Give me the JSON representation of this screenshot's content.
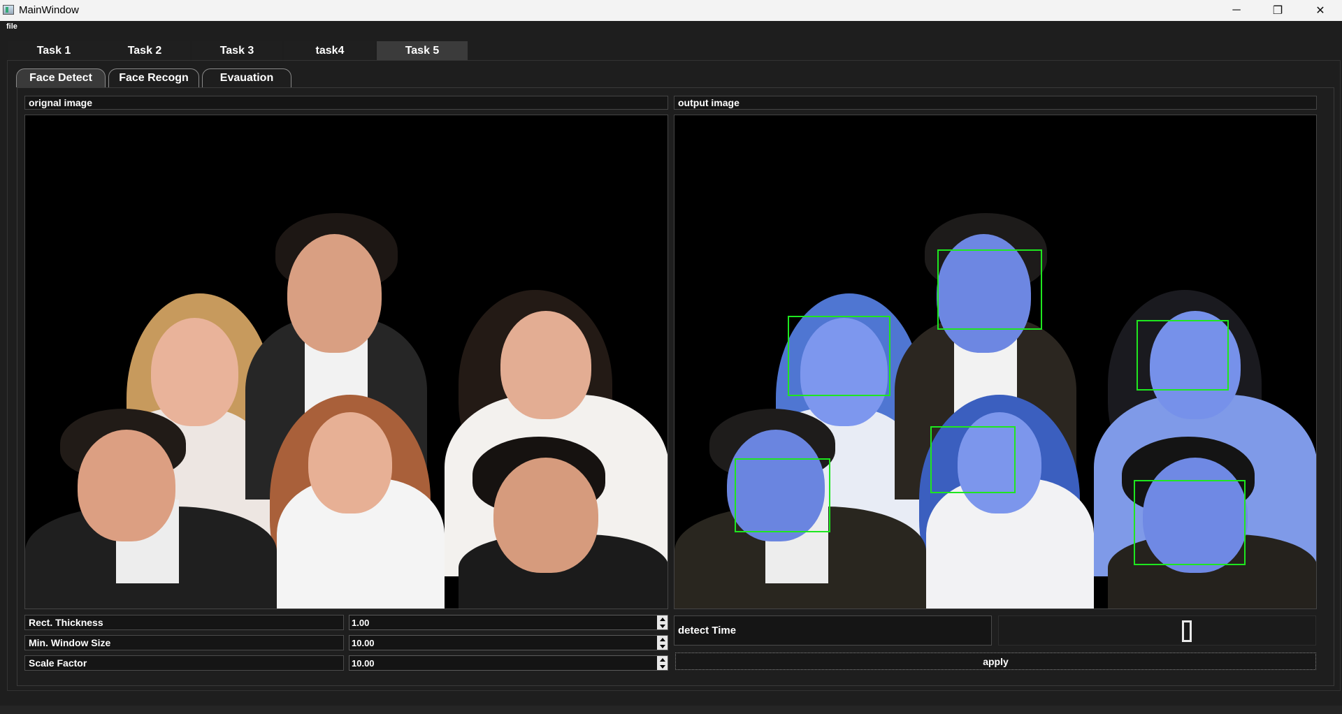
{
  "window": {
    "title": "MainWindow",
    "controls": {
      "minimize": "─",
      "maximize": "❐",
      "close": "✕"
    }
  },
  "menu": {
    "file": "file"
  },
  "main_tabs": [
    {
      "label": "Task 1"
    },
    {
      "label": "Task 2"
    },
    {
      "label": "Task 3"
    },
    {
      "label": "task4"
    },
    {
      "label": "Task 5",
      "active": true
    }
  ],
  "sub_tabs": [
    {
      "label": "Face Detect",
      "active": true
    },
    {
      "label": "Face Recogn"
    },
    {
      "label": "Evauation"
    }
  ],
  "face_detect": {
    "original_label": "orignal image",
    "output_label": "output image",
    "params": [
      {
        "label": "Rect. Thickness",
        "value": "1.00"
      },
      {
        "label": "Min. Window Size",
        "value": "10.00"
      },
      {
        "label": "Scale Factor",
        "value": "10.00"
      }
    ],
    "detect_time_label": "detect Time",
    "detect_time_value": "0",
    "apply_label": "apply",
    "faces_detected": 6
  },
  "colors": {
    "background": "#1e1e1e",
    "active_tab": "#3b3b3b",
    "face_box": "#1fe61f",
    "output_tint": "#6f8df0"
  }
}
